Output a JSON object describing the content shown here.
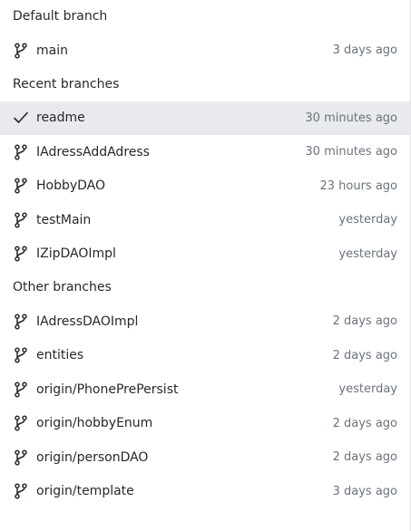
{
  "sections": [
    {
      "title": "Default branch",
      "branches": [
        {
          "name": "main",
          "time": "3 days ago",
          "icon": "git-branch-icon",
          "selected": false
        }
      ]
    },
    {
      "title": "Recent branches",
      "branches": [
        {
          "name": "readme",
          "time": "30 minutes ago",
          "icon": "check-icon",
          "selected": true
        },
        {
          "name": "IAdressAddAdress",
          "time": "30 minutes ago",
          "icon": "git-branch-icon",
          "selected": false
        },
        {
          "name": "HobbyDAO",
          "time": "23 hours ago",
          "icon": "git-branch-icon",
          "selected": false
        },
        {
          "name": "testMain",
          "time": "yesterday",
          "icon": "git-branch-icon",
          "selected": false
        },
        {
          "name": "IZipDAOImpl",
          "time": "yesterday",
          "icon": "git-branch-icon",
          "selected": false
        }
      ]
    },
    {
      "title": "Other branches",
      "branches": [
        {
          "name": "IAdressDAOImpl",
          "time": "2 days ago",
          "icon": "git-branch-icon",
          "selected": false
        },
        {
          "name": "entities",
          "time": "2 days ago",
          "icon": "git-branch-icon",
          "selected": false
        },
        {
          "name": "origin/PhonePrePersist",
          "time": "yesterday",
          "icon": "git-branch-icon",
          "selected": false
        },
        {
          "name": "origin/hobbyEnum",
          "time": "2 days ago",
          "icon": "git-branch-icon",
          "selected": false
        },
        {
          "name": "origin/personDAO",
          "time": "2 days ago",
          "icon": "git-branch-icon",
          "selected": false
        },
        {
          "name": "origin/template",
          "time": "3 days ago",
          "icon": "git-branch-icon",
          "selected": false
        }
      ]
    }
  ],
  "colors": {
    "selected_bg": "#e8eaed",
    "text": "#24292e",
    "muted": "#6a737d"
  }
}
